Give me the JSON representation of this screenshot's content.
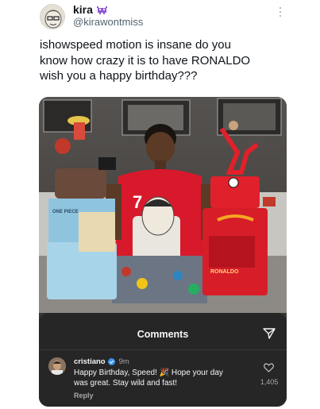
{
  "tweet": {
    "display_name": "kira",
    "name_emoji_icon": "alien-monster-icon",
    "handle": "@kirawontmiss",
    "text": "ishowspeed motion is insane do you\nknow how crazy it is to have RONALDO\nwish you a happy birthday???",
    "more_icon": "more-options-icon"
  },
  "photo": {
    "jersey_number": "7",
    "cake_left_label": "ONE PIECE",
    "cake_right_label": "RONALDO",
    "colors": {
      "jersey": "#d8192c",
      "cake_red": "#e0202b",
      "cake_blue": "#8fc4df",
      "wall": "#4a4743"
    }
  },
  "comments": {
    "title": "Comments",
    "share_icon": "send-icon",
    "username": "cristiano",
    "verified_icon": "verified-badge-icon",
    "time": "9m",
    "text": "Happy Birthday, Speed! 🎉 Hope your day\nwas great. Stay wild and fast!",
    "reply": "Reply",
    "like_icon": "heart-icon",
    "likes": "1,405"
  }
}
